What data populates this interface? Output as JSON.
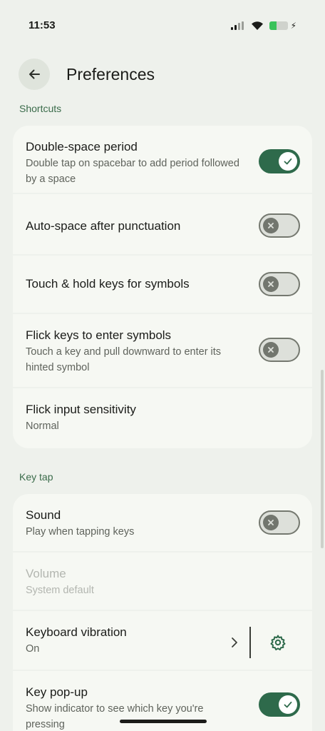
{
  "status_bar": {
    "time": "11:53"
  },
  "app_bar": {
    "title": "Preferences"
  },
  "sections": {
    "shortcuts": "Shortcuts",
    "key_tap": "Key tap"
  },
  "shortcuts": {
    "double_space": {
      "title": "Double-space period",
      "subtitle": "Double tap on spacebar to add period followed by a space",
      "enabled": true
    },
    "auto_space": {
      "title": "Auto-space after punctuation",
      "enabled": false
    },
    "touch_hold": {
      "title": "Touch & hold keys for symbols",
      "enabled": false
    },
    "flick_keys": {
      "title": "Flick keys to enter symbols",
      "subtitle": "Touch a key and pull downward to enter its hinted symbol",
      "enabled": false
    },
    "flick_sensitivity": {
      "title": "Flick input sensitivity",
      "subtitle": "Normal"
    }
  },
  "key_tap": {
    "sound": {
      "title": "Sound",
      "subtitle": "Play when tapping keys",
      "enabled": false
    },
    "volume": {
      "title": "Volume",
      "subtitle": "System default"
    },
    "vibration": {
      "title": "Keyboard vibration",
      "subtitle": "On"
    },
    "popup": {
      "title": "Key pop-up",
      "subtitle": "Show indicator to see which key you're pressing",
      "enabled": true
    }
  },
  "colors": {
    "accent": "#2e6a4b",
    "section_header": "#3a6b4a",
    "background": "#eef1ec",
    "card": "#f6f8f3"
  },
  "icons": {
    "back": "arrow-left-icon",
    "settings": "gear-icon",
    "chevron": "chevron-right-icon",
    "check": "check-icon",
    "close": "close-icon"
  }
}
